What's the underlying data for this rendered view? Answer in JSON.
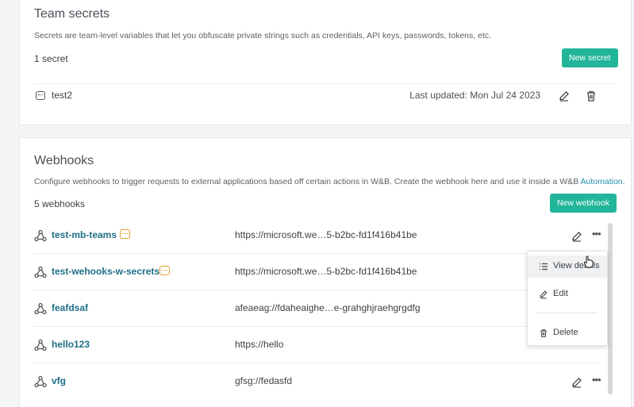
{
  "secrets": {
    "title": "Team secrets",
    "description": "Secrets are team-level variables that let you obfuscate private strings such as credentials, API keys, passwords, tokens, etc.",
    "count": "1 secret",
    "new_button": "New secret",
    "items": [
      {
        "name": "test2",
        "updated": "Last updated: Mon Jul 24 2023"
      }
    ]
  },
  "webhooks": {
    "title": "Webhooks",
    "description": "Configure webhooks to trigger requests to external applications based off certain actions in W&B. Create the webhook here and use it inside a W&B ",
    "description_link": "Automation",
    "description_end": ".",
    "count": "5 webhooks",
    "new_button": "New webhook",
    "items": [
      {
        "name": "test-mb-teams",
        "url": "https://microsoft.we…5-b2bc-fd1f416b41be",
        "has_secret": true
      },
      {
        "name": "test-wehooks-w-secrets",
        "url": "https://microsoft.we…5-b2bc-fd1f416b41be",
        "has_secret": true
      },
      {
        "name": "feafdsaf",
        "url": "afeaeag://fdaheaighe…e-grahghjraehgrgdfg",
        "has_secret": false
      },
      {
        "name": "hello123",
        "url": "https://hello",
        "has_secret": false
      },
      {
        "name": "vfg",
        "url": "gfsg://fedasfd",
        "has_secret": false
      }
    ]
  },
  "context_menu": {
    "items": [
      "View details",
      "Edit",
      "Delete"
    ]
  },
  "colors": {
    "accent": "#23b59a",
    "link": "#1f6f87",
    "secret_badge": "#e0a230"
  }
}
